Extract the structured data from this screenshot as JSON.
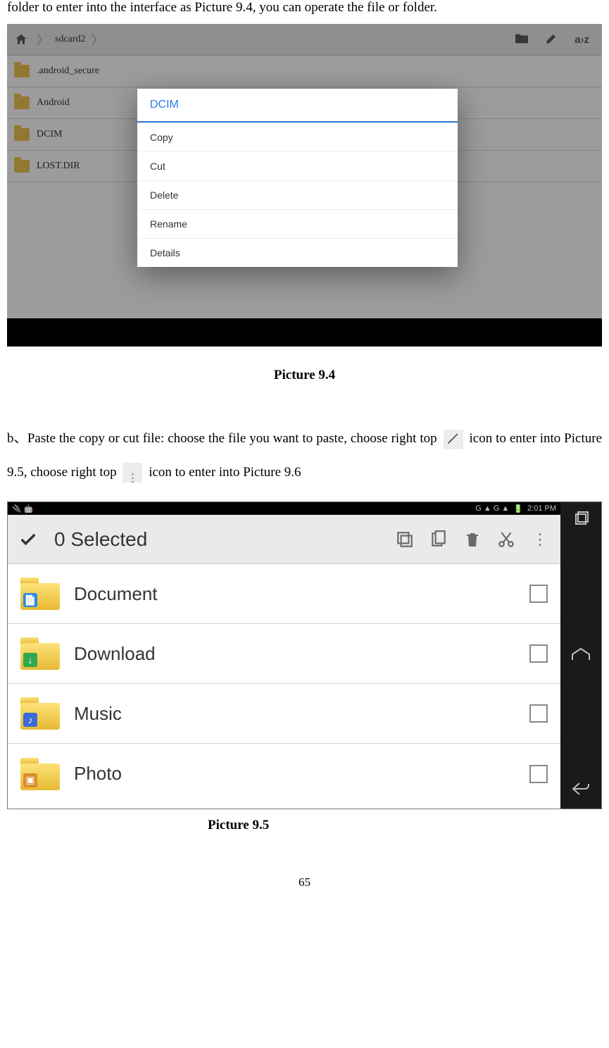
{
  "intro": "folder to enter into the interface as Picture 9.4, you can operate the file or folder.",
  "shot1": {
    "breadcrumb": "sdcard2",
    "rows": [
      ".android_secure",
      "Android",
      "DCIM",
      "LOST.DIR"
    ],
    "dialog_title": "DCIM",
    "dialog_items": [
      "Copy",
      "Cut",
      "Delete",
      "Rename",
      "Details"
    ],
    "sort_label": "a›z"
  },
  "caption1": "Picture 9.4",
  "para_b_1": "b、Paste the copy or cut file: choose the file you want to paste, choose right top ",
  "para_b_2": " icon to enter into Picture 9.5, choose right top ",
  "para_b_3": " icon to enter into Picture 9.6",
  "shot2": {
    "status_left": "🔌  🤖",
    "status_right_net": "G ▲ G ▲",
    "status_right_batt": "🔋",
    "status_time": "2:01 PM",
    "selected": "0 Selected",
    "rows": [
      {
        "label": "Document",
        "badge": "📄",
        "badgeClass": "badge-doc"
      },
      {
        "label": "Download",
        "badge": "↓",
        "badgeClass": "badge-dl"
      },
      {
        "label": "Music",
        "badge": "♪",
        "badgeClass": "badge-music"
      },
      {
        "label": "Photo",
        "badge": "▣",
        "badgeClass": "badge-photo"
      }
    ]
  },
  "caption2": "Picture 9.5",
  "page_number": "65"
}
